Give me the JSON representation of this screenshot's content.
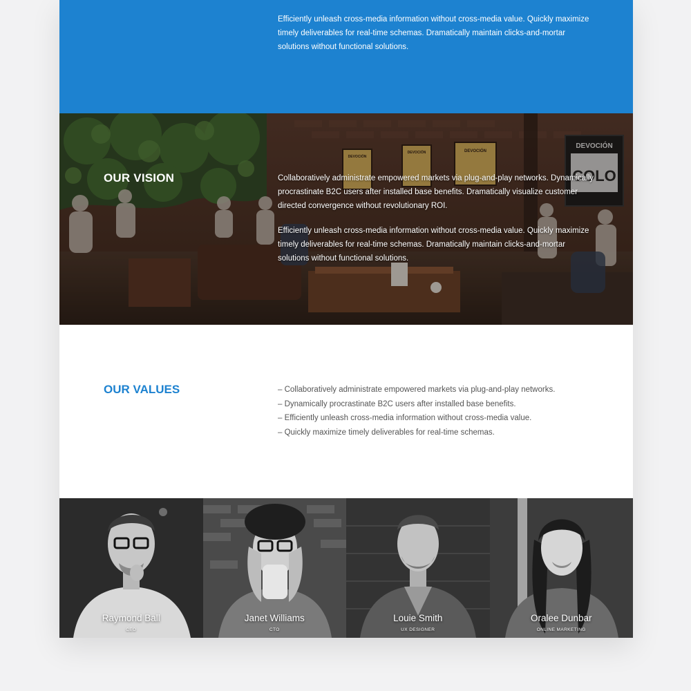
{
  "mission": {
    "text": "Efficiently unleash cross-media information without cross-media value. Quickly maximize timely deliverables for real-time schemas. Dramatically maintain clicks-and-mortar solutions without functional solutions.",
    "background_color": "#1d82d0"
  },
  "vision": {
    "title": "OUR VISION",
    "paragraph1": "Collaboratively administrate empowered markets via plug-and-play networks. Dynamically procrastinate B2C users after installed base benefits. Dramatically visualize customer directed convergence without revolutionary ROI.",
    "paragraph2": "Efficiently unleash cross-media information without cross-media value. Quickly maximize timely deliverables for real-time schemas. Dramatically maintain clicks-and-mortar solutions without functional solutions.",
    "signs": [
      "DEVOCIÓN",
      "DEVOCIÓN",
      "DEVOCIÓN",
      "DEVOCIÓN",
      "COLO"
    ]
  },
  "values": {
    "title": "OUR VALUES",
    "title_color": "#1d82d0",
    "items": [
      "– Collaboratively administrate empowered markets via plug-and-play networks.",
      "– Dynamically procrastinate B2C users after installed base benefits.",
      "– Efficiently unleash cross-media information without cross-media value.",
      "– Quickly maximize timely deliverables for real-time schemas."
    ]
  },
  "team": [
    {
      "name": "Raymond Ball",
      "role": "CEO"
    },
    {
      "name": "Janet Williams",
      "role": "CTO"
    },
    {
      "name": "Louie Smith",
      "role": "UX DESIGNER"
    },
    {
      "name": "Oralee Dunbar",
      "role": "ONLINE MARKETING"
    }
  ]
}
